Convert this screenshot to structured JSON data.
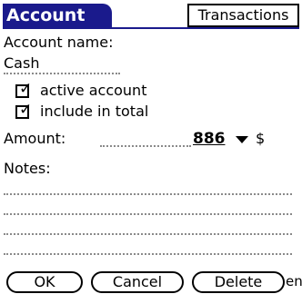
{
  "header": {
    "title": "Account",
    "tab_transactions": "Transactions"
  },
  "form": {
    "account_name_label": "Account name:",
    "account_name_value": "Cash",
    "active_label": "active account",
    "active_checked": true,
    "include_label": "include in total",
    "include_checked": true,
    "amount_label": "Amount:",
    "amount_value": "886",
    "currency": "$",
    "notes_label": "Notes:"
  },
  "buttons": {
    "ok": "OK",
    "cancel": "Cancel",
    "delete": "Delete",
    "trailing_text": "en"
  },
  "colors": {
    "accent": "#1a1a8c"
  },
  "icons": {
    "check": "check-icon",
    "dropdown": "dropdown-triangle-icon"
  }
}
